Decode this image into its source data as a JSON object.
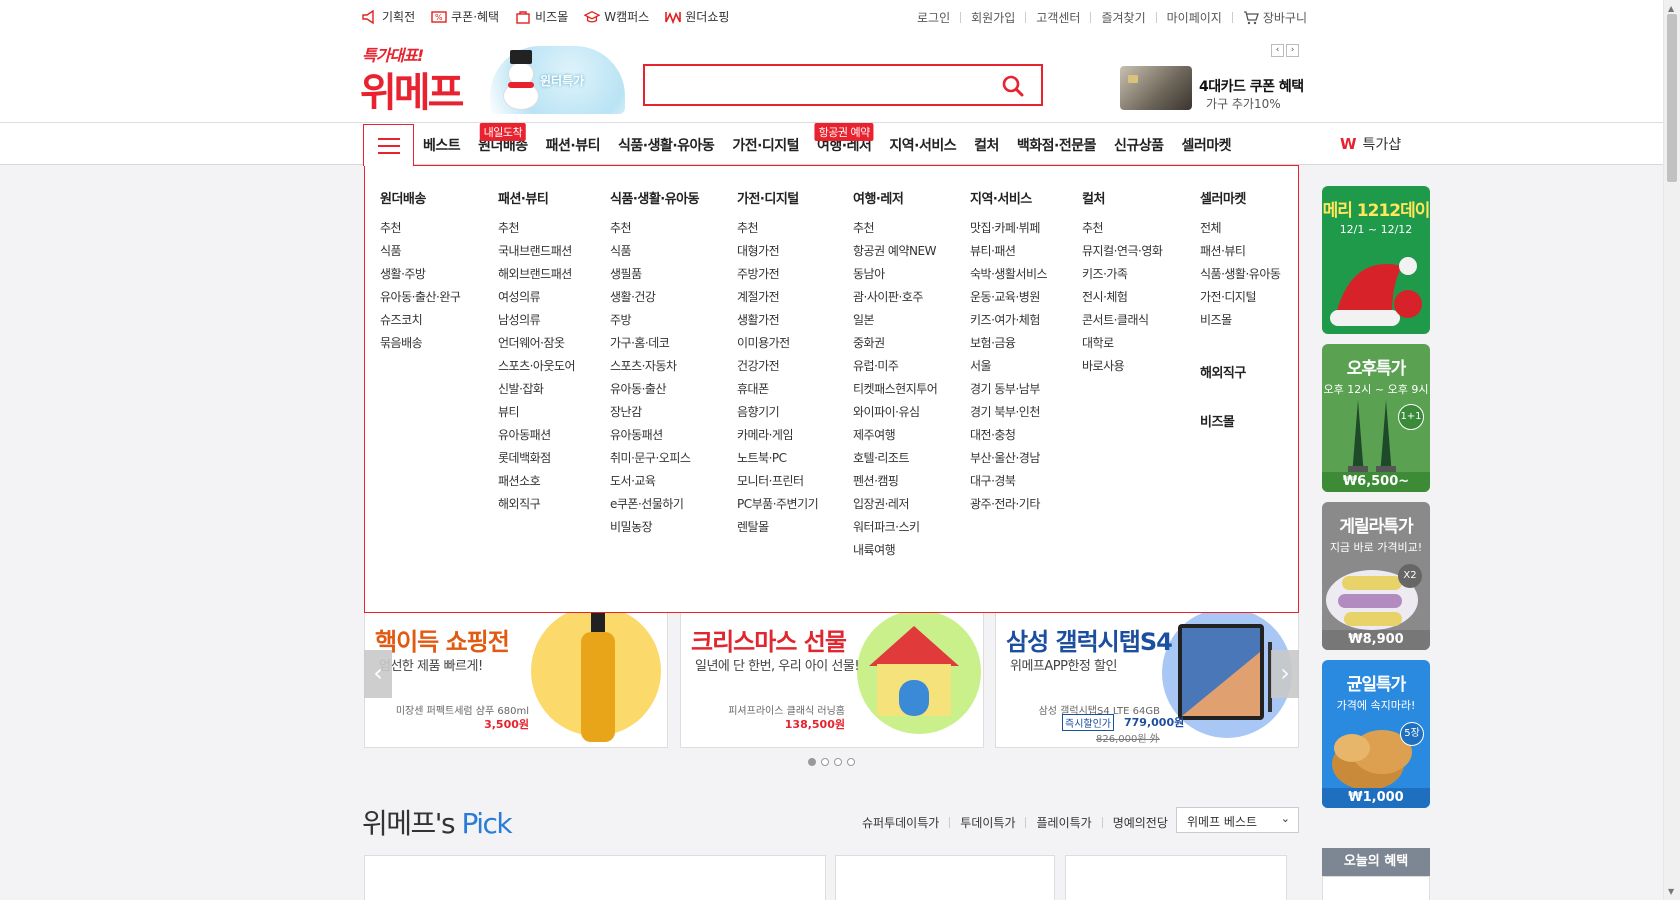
{
  "util_left": [
    {
      "label": "기획전",
      "icon": "megaphone-icon"
    },
    {
      "label": "쿠폰·혜택",
      "icon": "coupon-icon"
    },
    {
      "label": "비즈몰",
      "icon": "bag-icon"
    },
    {
      "label": "W캠퍼스",
      "icon": "graduation-cap-icon"
    },
    {
      "label": "원더쇼핑",
      "icon": "wonder-logo-icon"
    }
  ],
  "util_right": [
    "로그인",
    "회원가입",
    "고객센터",
    "즐겨찾기",
    "마이페이지",
    "장바구니"
  ],
  "logo": {
    "sub": "특가대표!",
    "main": "위메프"
  },
  "promo": {
    "label": "윈터특가"
  },
  "search": {
    "placeholder": ""
  },
  "card_promo": {
    "title": "4대카드 쿠폰 혜택",
    "sub": "가구 추가10%"
  },
  "nav": [
    {
      "label": "베스트",
      "tag": ""
    },
    {
      "label": "원더배송",
      "tag": "내일도착"
    },
    {
      "label": "패션·뷰티",
      "tag": ""
    },
    {
      "label": "식품·생활·유아동",
      "tag": ""
    },
    {
      "label": "가전·디지털",
      "tag": ""
    },
    {
      "label": "여행·레저",
      "tag": "항공권 예약"
    },
    {
      "label": "지역·서비스",
      "tag": ""
    },
    {
      "label": "컬처",
      "tag": ""
    },
    {
      "label": "백화점·전문몰",
      "tag": ""
    },
    {
      "label": "신규상품",
      "tag": ""
    },
    {
      "label": "셀러마켓",
      "tag": ""
    }
  ],
  "nav_right": {
    "badge": "W",
    "label": "특가샵"
  },
  "mega_menu": [
    {
      "title": "원더배송",
      "items": [
        "추천",
        "식품",
        "생활·주방",
        "유아동·출산·완구",
        "슈즈코치",
        "묶음배송"
      ]
    },
    {
      "title": "패션·뷰티",
      "items": [
        "추천",
        "국내브랜드패션",
        "해외브랜드패션",
        "여성의류",
        "남성의류",
        "언더웨어·잠옷",
        "스포츠·아웃도어",
        "신발·잡화",
        "뷰티",
        "유아동패션",
        "롯데백화점",
        "패션소호",
        "해외직구"
      ]
    },
    {
      "title": "식품·생활·유아동",
      "items": [
        "추천",
        "식품",
        "생필품",
        "생활·건강",
        "주방",
        "가구·홈·데코",
        "스포츠·자동차",
        "유아동·출산",
        "장난감",
        "유아동패션",
        "취미·문구·오피스",
        "도서·교육",
        "e쿠폰·선물하기",
        "비밀농장"
      ]
    },
    {
      "title": "가전·디지털",
      "items": [
        "추천",
        "대형가전",
        "주방가전",
        "계절가전",
        "생활가전",
        "이미용가전",
        "건강가전",
        "휴대폰",
        "음향기기",
        "카메라·게임",
        "노트북·PC",
        "모니터·프린터",
        "PC부품·주변기기",
        "렌탈몰"
      ]
    },
    {
      "title": "여행·레저",
      "items": [
        "추천",
        "항공권 예약NEW",
        "동남아",
        "괌·사이판·호주",
        "일본",
        "중화권",
        "유럽·미주",
        "티켓패스현지투어",
        "와이파이·유심",
        "제주여행",
        "호텔·리조트",
        "펜션·캠핑",
        "입장권·레저",
        "워터파크·스키",
        "내륙여행"
      ]
    },
    {
      "title": "지역·서비스",
      "items": [
        "맛집·카페·뷔페",
        "뷰티·패션",
        "숙박·생활서비스",
        "운동·교육·병원",
        "키즈·여가·체험",
        "보험·금융",
        "서울",
        "경기 동부·남부",
        "경기 북부·인천",
        "대전·충청",
        "부산·울산·경남",
        "대구·경북",
        "광주·전라·기타"
      ]
    },
    {
      "title": "컬처",
      "items": [
        "추천",
        "뮤지컬·연극·영화",
        "키즈·가족",
        "전시·체험",
        "콘서트·클래식",
        "대학로",
        "바로사용"
      ]
    },
    {
      "title": "셀러마켓",
      "items": [
        "전체",
        "패션·뷰티",
        "식품·생활·유아동",
        "가전·디지털",
        "비즈몰"
      ],
      "extra": [
        "해외직구",
        "비즈몰"
      ]
    }
  ],
  "side_banners": [
    {
      "title": "메리 1212데이",
      "sub": "12/1 ~ 12/12",
      "price": "",
      "color": "#1f9a4a"
    },
    {
      "title": "오후특가",
      "sub": "오후 12시 ~ 오후 9시",
      "price": "₩6,500~",
      "badge": "1+1",
      "color": "#5aa152"
    },
    {
      "title": "게릴라특가",
      "sub": "지금 바로 가격비교!",
      "price": "₩8,900",
      "badge": "X2",
      "color": "#8a8a8a"
    },
    {
      "title": "균일특가",
      "sub": "가격에 속지마라!",
      "price": "₩1,000",
      "badge": "5장",
      "color": "#2a8ae0"
    }
  ],
  "carousel": [
    {
      "title": "핵이득 쇼핑전",
      "desc": "엄선한 제품 빠르게!",
      "name": "미장센 퍼펙트세럼 샴푸 680ml",
      "price": "3,500원",
      "title_color": "#e05a12",
      "circle": "#fbd96a"
    },
    {
      "title": "크리스마스 선물",
      "desc": "일년에 단 한번, 우리 아이 선물!",
      "name": "피셔프라이스 클래식 러닝홈",
      "price": "138,500원",
      "title_color": "#e0262e",
      "circle": "#c9f08a"
    },
    {
      "title": "삼성 갤럭시탭S4",
      "desc": "위메프APP한정 할인",
      "name": "삼성 갤럭시탭S4 LTE 64GB",
      "badge": "즉시할인가",
      "price": "779,000원",
      "orig": "826,000원 外",
      "title_color": "#1c4fa0",
      "circle": "#a9c7f5"
    }
  ],
  "pick": {
    "title_a": "위메프's",
    "title_b": " Pick",
    "links": [
      "슈퍼투데이특가",
      "투데이특가",
      "플레이특가",
      "명예의전당"
    ],
    "select": "위메프 베스트"
  },
  "today": {
    "label": "오늘의 혜택"
  }
}
